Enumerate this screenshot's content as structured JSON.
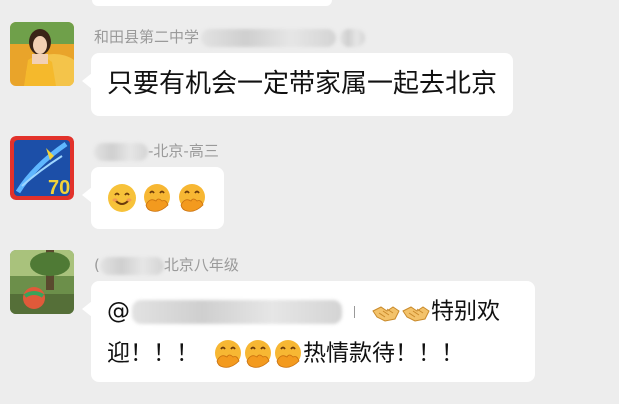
{
  "chat": {
    "messages": [
      {
        "sender_prefix": "和田县第二中学",
        "sender_suffix": "",
        "text": "只要有机会一定带家属一起去北京"
      },
      {
        "sender_prefix": "",
        "sender_suffix": "-北京-高三",
        "avatar_badge": "70",
        "emoji": [
          "smiling-face",
          "face-with-hand-over-mouth",
          "face-with-hand-over-mouth"
        ]
      },
      {
        "sender_prefix": "(",
        "sender_suffix": "北京八年级",
        "mention_at": "@",
        "line1_tail": "特别欢",
        "line2_start": "迎！！！",
        "line2_middle": "热情款待！！！"
      }
    ]
  },
  "colors": {
    "background": "#ededed",
    "bubble": "#ffffff",
    "name_text": "#9a9a9a",
    "message_text": "#111111",
    "emoji_yellow": "#f7b733"
  }
}
